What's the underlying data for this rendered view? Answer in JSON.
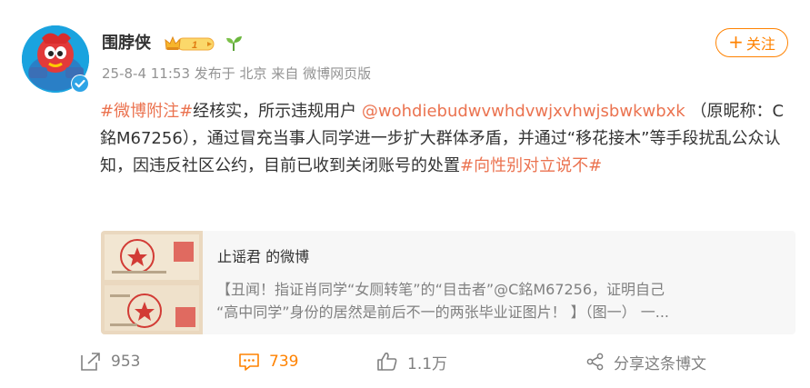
{
  "user": {
    "name": "围脖侠",
    "vip_level": "1",
    "timestamp": "25-8-4 11:53",
    "location": "发布于 北京",
    "source": "来自 微博网页版"
  },
  "follow": {
    "plus": "+",
    "label": "关注"
  },
  "post": {
    "hashtag1": "#微博附注#",
    "text1": "经核实，所示违规用户",
    "mention": "@wohdiebudwvwhdvwjxvhwjsbwkwbxk",
    "text2": "（原昵称：C銘M67256），通过冒充当事人同学进一步扩大群体矛盾，并通过“移花接木”等手段扰乱公众认知，因违反社区公约，目前已收到关闭账号的处置",
    "hashtag2": "#向性别对立说不#"
  },
  "repost": {
    "title": "止谣君 的微博",
    "line1": "【丑闻！指证肖同学“女厕转笔”的“目击者”@C銘M67256，证明自己",
    "line2": "“高中同学”身份的居然是前后不一的两张毕业证图片！ 】（图一） 一..."
  },
  "actions": {
    "repost_count": "953",
    "comment_count": "739",
    "like_count": "1.1万",
    "share_label": "分享这条博文"
  },
  "colors": {
    "accent": "#ff8200",
    "link": "#eb7350",
    "meta": "#939393"
  },
  "icons": [
    "verified-badge-icon",
    "vip-crown-icon",
    "sprout-icon",
    "repost-icon",
    "comment-icon",
    "like-icon",
    "share-icon"
  ]
}
